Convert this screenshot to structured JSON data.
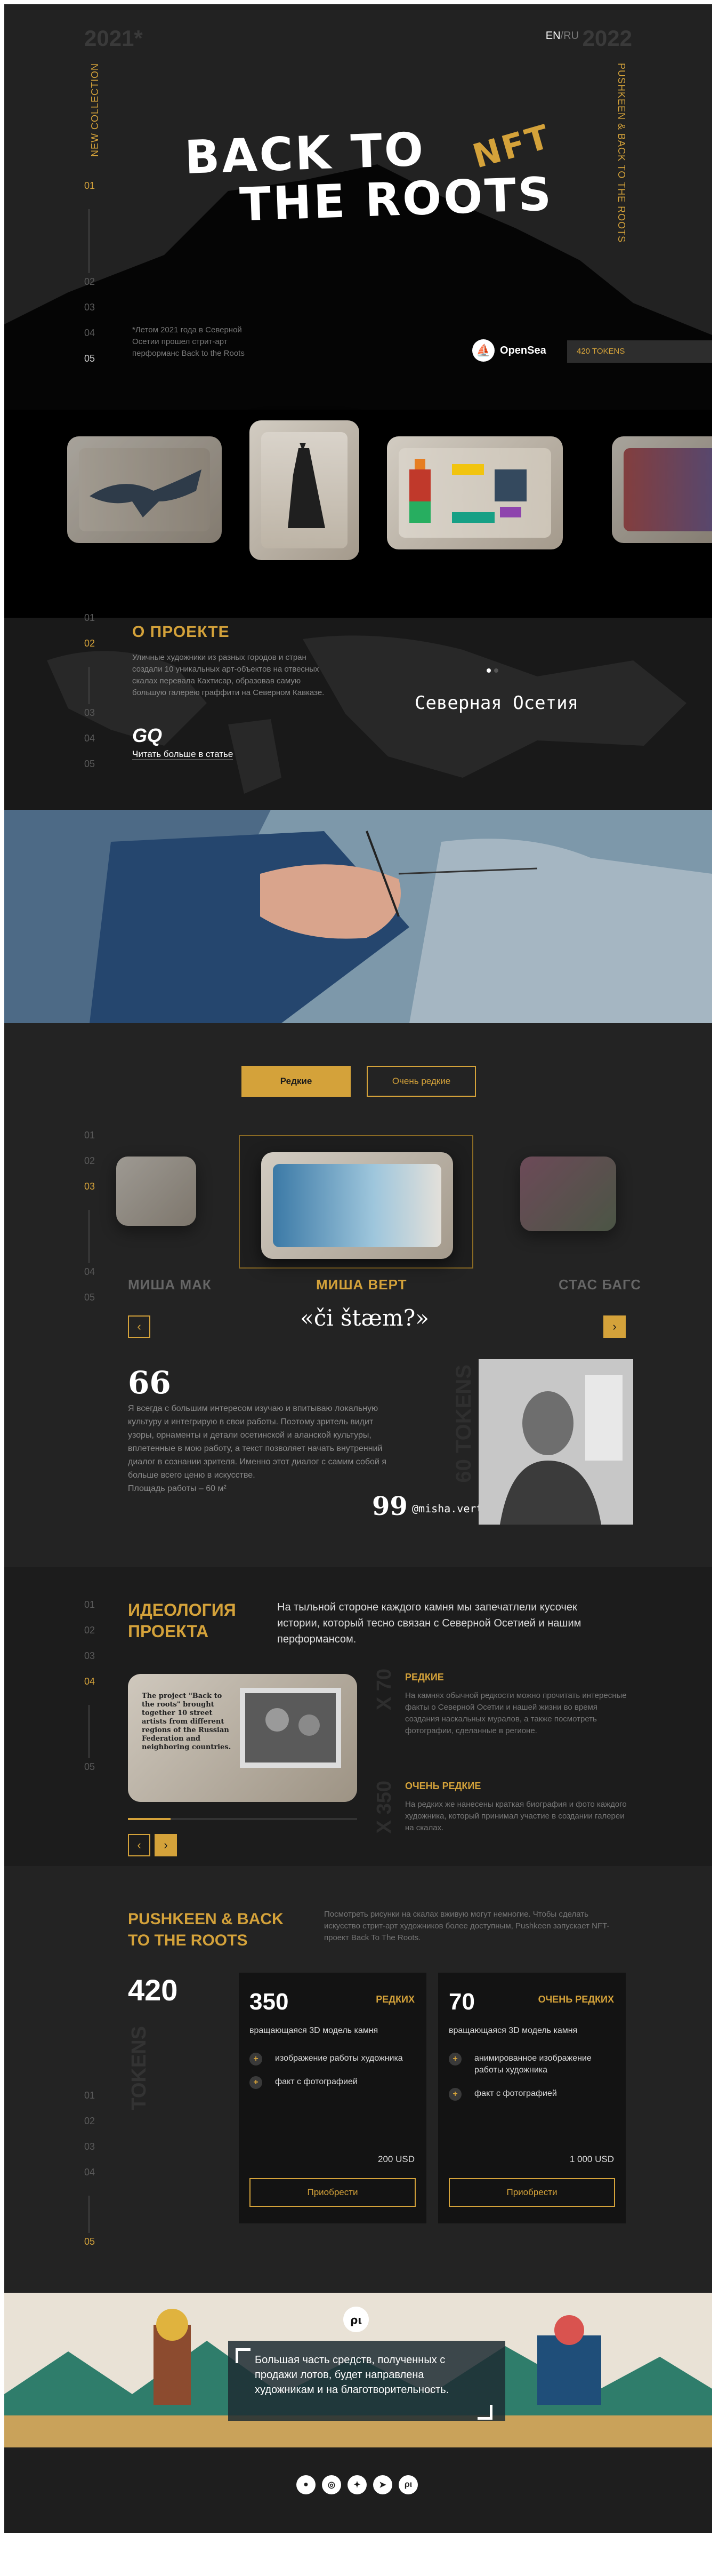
{
  "hero": {
    "year_left": "2021*",
    "year_right": "2022",
    "lang_en": "EN",
    "lang_sep": "/",
    "lang_ru": "RU",
    "vertical_left": "NEW COLLECTION",
    "vertical_right": "PUSHKEEN & BACK TO THE ROOTS",
    "nums": [
      "01",
      "02",
      "03",
      "04",
      "05"
    ],
    "title_line1": "BACK TO",
    "title_line2": "THE ROOTS",
    "nft": "NFT",
    "caption": "*Летом 2021 года в Северной Осетии прошел стрит-арт перформанс Back to the Roots",
    "opensea_label": "OpenSea",
    "tokens_label": "420 TOKENS"
  },
  "about": {
    "nums": [
      "01",
      "02",
      "03",
      "04",
      "05"
    ],
    "title": "О ПРОЕКТЕ",
    "text": "Уличные художники из разных городов и стран создали 10 уникальных арт-объектов на отвесных скалах перевала Кахтисар, образовав самую большую галерею граффити на Северном Кавказе.",
    "gq": "GQ",
    "read_more": "Читать больше в статье",
    "region": "Северная Осетия"
  },
  "gallery": {
    "tab_rare": "Редкие",
    "tab_very_rare": "Очень редкие",
    "nums": [
      "01",
      "02",
      "03",
      "04",
      "05"
    ],
    "artists": [
      "МИША МАК",
      "МИША ВЕРТ",
      "СТАС БАГС"
    ],
    "prev": "‹",
    "next": "›",
    "signature": "«či štæm?»",
    "open_quote": "66",
    "quote": "Я всегда с большим интересом изучаю и впитываю локальную культуру и интегрирую в свои работы. Поэтому зритель видит узоры, орнаменты и детали осетинской и аланской культуры, вплетенные в мою работу, а текст позволяет начать внутренний диалог в сознании зрителя. Именно этот диалог с самим собой я больше всего ценю в искусстве.",
    "area": "Площадь работы – 60 м²",
    "close_quote": "99",
    "handle": "@misha.vert",
    "tokens_vert": "60 TOKENS"
  },
  "ideology": {
    "nums": [
      "01",
      "02",
      "03",
      "04",
      "05"
    ],
    "title": "ИДЕОЛОГИЯ ПРОЕКТА",
    "lead": "На тыльной стороне каждого камня мы запечатлели кусочек истории, который тесно связан с Северной Осетией и нашим перформансом.",
    "stone_text": "The project \"Back to the roots\" brought together 10 street artists from different regions of the Russian Federation and neighboring countries.",
    "x70": "X 70",
    "rare_title": "РЕДКИЕ",
    "rare_text": "На камнях обычной редкости можно прочитать интересные факты о Северной Осетии и нашей жизни во время создания наскальных муралов, а также посмотреть фотографии, сделанные в регионе.",
    "x350": "X 350",
    "very_rare_title": "ОЧЕНЬ РЕДКИЕ",
    "very_rare_text": "На редких же нанесены краткая биография и фото каждого художника, который принимал участие в создании галереи на скалах.",
    "prev": "‹",
    "next": "›"
  },
  "tokens": {
    "title": "PUSHKEEN & BACK TO THE ROOTS",
    "desc": "Посмотреть рисунки на скалах вживую могут немногие. Чтобы сделать искусство стрит-арт художников более доступным, Pushkeen запускает NFT-проект Back To The Roots.",
    "total": "420",
    "tokens_vert": "TOKENS",
    "nums": [
      "01",
      "02",
      "03",
      "04",
      "05"
    ],
    "card1": {
      "num": "350",
      "kind": "РЕДКИХ",
      "sub": "вращающаяся 3D модель камня",
      "items": [
        "изображение работы художника",
        "факт с фотографией"
      ],
      "price": "200 USD",
      "buy": "Приобрести"
    },
    "card2": {
      "num": "70",
      "kind": "ОЧЕНЬ РЕДКИХ",
      "sub": "вращающаяся 3D модель камня",
      "items": [
        "анимированное изображение работы художника",
        "факт с фотографией"
      ],
      "price": "1 000 USD",
      "buy": "Приобрести"
    }
  },
  "mural": {
    "message": "Большая часть средств, полученных с продажи лотов, будет направлена художникам и на благотворительность."
  },
  "footer": {
    "socials": [
      "reddit-icon",
      "instagram-icon",
      "twitter-icon",
      "telegram-icon",
      "pushkeen-icon"
    ]
  },
  "colors": {
    "accent": "#d4a23a",
    "bg_dark": "#222222",
    "bg_darker": "#191919"
  }
}
